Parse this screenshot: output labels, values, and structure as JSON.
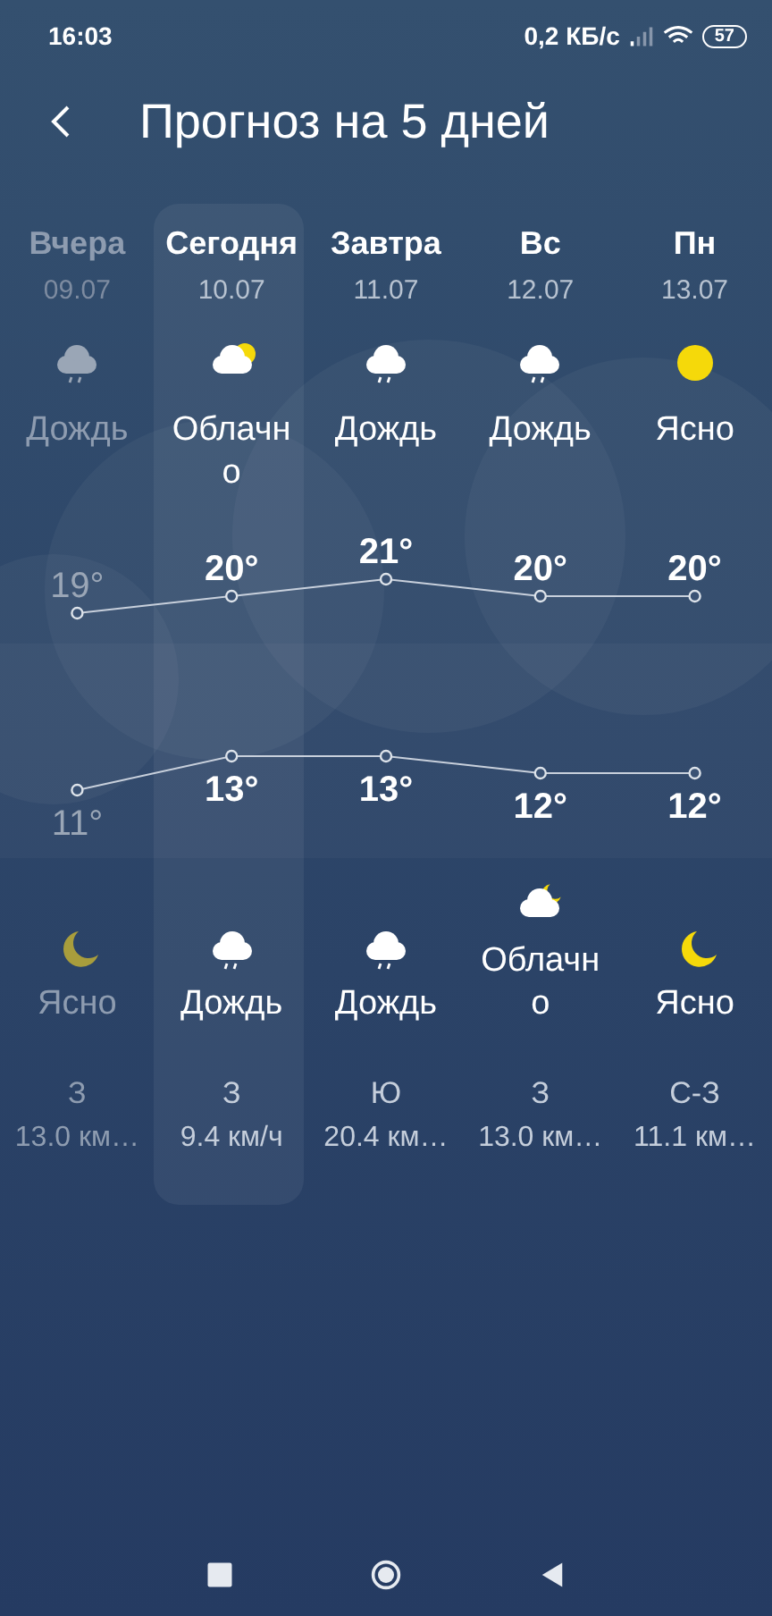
{
  "status_bar": {
    "time": "16:03",
    "network_speed": "0,2 КБ/с",
    "battery": "57"
  },
  "header": {
    "title": "Прогноз на 5 дней"
  },
  "days": [
    {
      "name": "Вчера",
      "date": "09.07",
      "past": true,
      "selected": false,
      "day": {
        "kind": "rain",
        "condition": "Дождь"
      },
      "high": "19°",
      "low": "11°",
      "night": {
        "kind": "moon",
        "condition": "Ясно"
      },
      "wind_direction": "З",
      "wind_speed": "13.0 км…"
    },
    {
      "name": "Сегодня",
      "date": "10.07",
      "past": false,
      "selected": true,
      "day": {
        "kind": "partly-cloudy",
        "condition": "Облачно"
      },
      "high": "20°",
      "low": "13°",
      "night": {
        "kind": "rain",
        "condition": "Дождь"
      },
      "wind_direction": "З",
      "wind_speed": "9.4 км/ч"
    },
    {
      "name": "Завтра",
      "date": "11.07",
      "past": false,
      "selected": false,
      "day": {
        "kind": "rain",
        "condition": "Дождь"
      },
      "high": "21°",
      "low": "13°",
      "night": {
        "kind": "rain",
        "condition": "Дождь"
      },
      "wind_direction": "Ю",
      "wind_speed": "20.4 км…"
    },
    {
      "name": "Вс",
      "date": "12.07",
      "past": false,
      "selected": false,
      "day": {
        "kind": "rain",
        "condition": "Дождь"
      },
      "high": "20°",
      "low": "12°",
      "night": {
        "kind": "cloudy-night",
        "condition": "Облачно"
      },
      "wind_direction": "З",
      "wind_speed": "13.0 км…"
    },
    {
      "name": "Пн",
      "date": "13.07",
      "past": false,
      "selected": false,
      "day": {
        "kind": "sun",
        "condition": "Ясно"
      },
      "high": "20°",
      "low": "12°",
      "night": {
        "kind": "moon",
        "condition": "Ясно"
      },
      "wind_direction": "С-З",
      "wind_speed": "11.1 км…"
    }
  ]
}
